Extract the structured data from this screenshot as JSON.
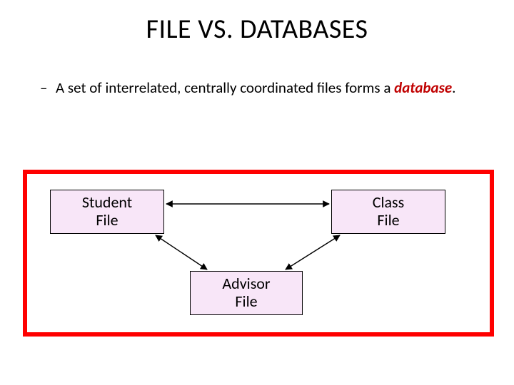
{
  "title": "FILE VS. DATABASES",
  "bullet": {
    "lead": "A set of interrelated, centrally coordinated files forms a",
    "keyword": "database",
    "trail": "."
  },
  "boxes": {
    "student": {
      "line1": "Student",
      "line2": "File"
    },
    "class": {
      "line1": "Class",
      "line2": "File"
    },
    "advisor": {
      "line1": "Advisor",
      "line2": "File"
    }
  },
  "colors": {
    "frame": "#ff0000",
    "box_fill": "#f8e6f8",
    "keyword": "#c00000"
  }
}
